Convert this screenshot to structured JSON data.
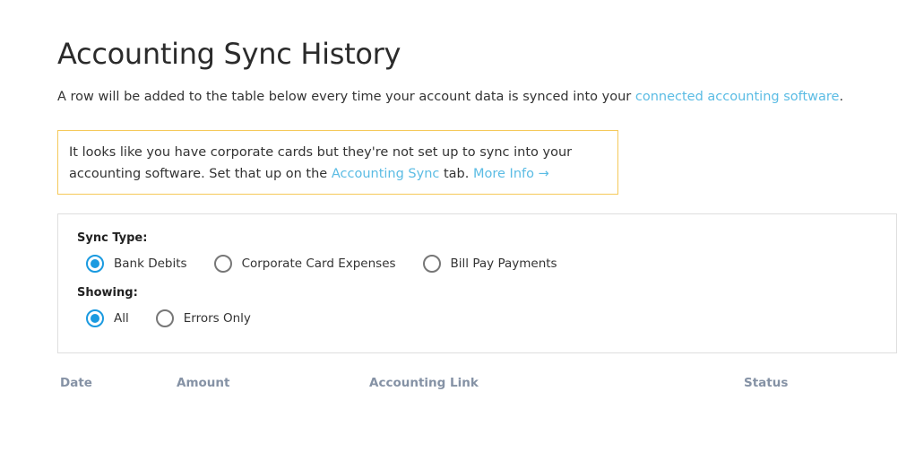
{
  "page": {
    "title": "Accounting Sync History"
  },
  "intro": {
    "text_before_link": "A row will be added to the table below every time your account data is synced into your ",
    "link_label": "connected accounting software",
    "text_after_link": "."
  },
  "notice": {
    "text_before_link": "It looks like you have corporate cards but they're not set up to sync into your accounting software. Set that up on the ",
    "link_label": "Accounting Sync",
    "text_middle": " tab. ",
    "more_info_label": "More Info →"
  },
  "filters": {
    "sync_type": {
      "label": "Sync Type:",
      "options": [
        {
          "label": "Bank Debits",
          "selected": true
        },
        {
          "label": "Corporate Card Expenses",
          "selected": false
        },
        {
          "label": "Bill Pay Payments",
          "selected": false
        }
      ]
    },
    "showing": {
      "label": "Showing:",
      "options": [
        {
          "label": "All",
          "selected": true
        },
        {
          "label": "Errors Only",
          "selected": false
        }
      ]
    }
  },
  "table": {
    "columns": [
      "Date",
      "Amount",
      "Accounting Link",
      "Status"
    ],
    "rows": []
  },
  "colors": {
    "link": "#5bbce4",
    "radio_selected": "#1a9ae0",
    "notice_border": "#f5c95a",
    "column_header": "#8592a5"
  }
}
